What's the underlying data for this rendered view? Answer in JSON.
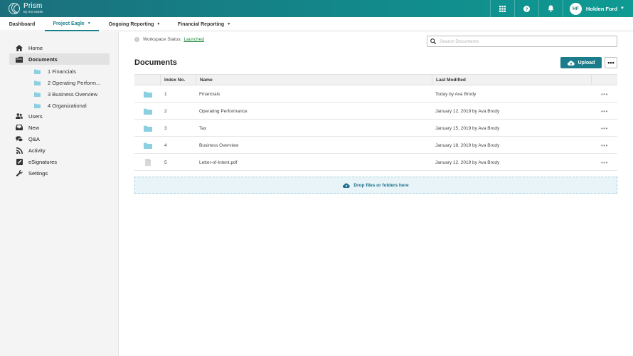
{
  "app": {
    "logo_name": "Prism",
    "logo_sub": "By IHS Markit"
  },
  "topbar": {
    "icons": [
      "grid-icon",
      "help-icon",
      "bell-icon"
    ],
    "user_initials": "HF",
    "user_name": "Holden Ford"
  },
  "tabs": [
    {
      "label": "Dashboard",
      "active": false,
      "has_menu": false
    },
    {
      "label": "Project Eagle",
      "active": true,
      "has_menu": true
    },
    {
      "label": "Ongoing Reporting",
      "active": false,
      "has_menu": true
    },
    {
      "label": "Financial Reporting",
      "active": false,
      "has_menu": true
    }
  ],
  "sidebar": {
    "items": [
      {
        "label": "Home",
        "icon": "home-icon"
      },
      {
        "label": "Documents",
        "icon": "documents-icon",
        "active": true
      },
      {
        "label": "Users",
        "icon": "users-icon"
      },
      {
        "label": "New",
        "icon": "inbox-icon"
      },
      {
        "label": "Q&A",
        "icon": "chat-icon"
      },
      {
        "label": "Activity",
        "icon": "rss-icon"
      },
      {
        "label": "eSignatures",
        "icon": "signature-icon"
      },
      {
        "label": "Settings",
        "icon": "wrench-icon"
      }
    ],
    "folders": [
      {
        "label": "1 Financials"
      },
      {
        "label": "2 Operating Perform..."
      },
      {
        "label": "3 Business Overview"
      },
      {
        "label": "4 Organizational"
      }
    ]
  },
  "workspace_status": {
    "label": "Workspace Status:",
    "value": "Launched"
  },
  "search": {
    "placeholder": "Search Documents"
  },
  "main": {
    "title": "Documents",
    "upload_label": "Upload",
    "more_label": "•••"
  },
  "table": {
    "columns": [
      "Index No.",
      "Name",
      "Last Modified"
    ],
    "rows": [
      {
        "type": "folder",
        "index": "1",
        "name": "Financials",
        "modified": "Today by Ava Brody"
      },
      {
        "type": "folder",
        "index": "2",
        "name": "Operating Performance",
        "modified": "January 12, 2019 by Ava Brody"
      },
      {
        "type": "folder",
        "index": "3",
        "name": "Tax",
        "modified": "January 15, 2019 by Ava Brody"
      },
      {
        "type": "folder",
        "index": "4",
        "name": "Business Overview",
        "modified": "January 18, 2019 by Ava Brody"
      },
      {
        "type": "file",
        "index": "5",
        "name": "Letter-of-Intent.pdf",
        "modified": "January 12, 2019 by Ava Brody"
      }
    ],
    "row_more_label": "•••"
  },
  "dropzone": {
    "label": "Drop files or folders here"
  },
  "colors": {
    "brand": "#1b7d8c",
    "folder": "#8ccfe0",
    "status_link": "#1a8a3a"
  }
}
